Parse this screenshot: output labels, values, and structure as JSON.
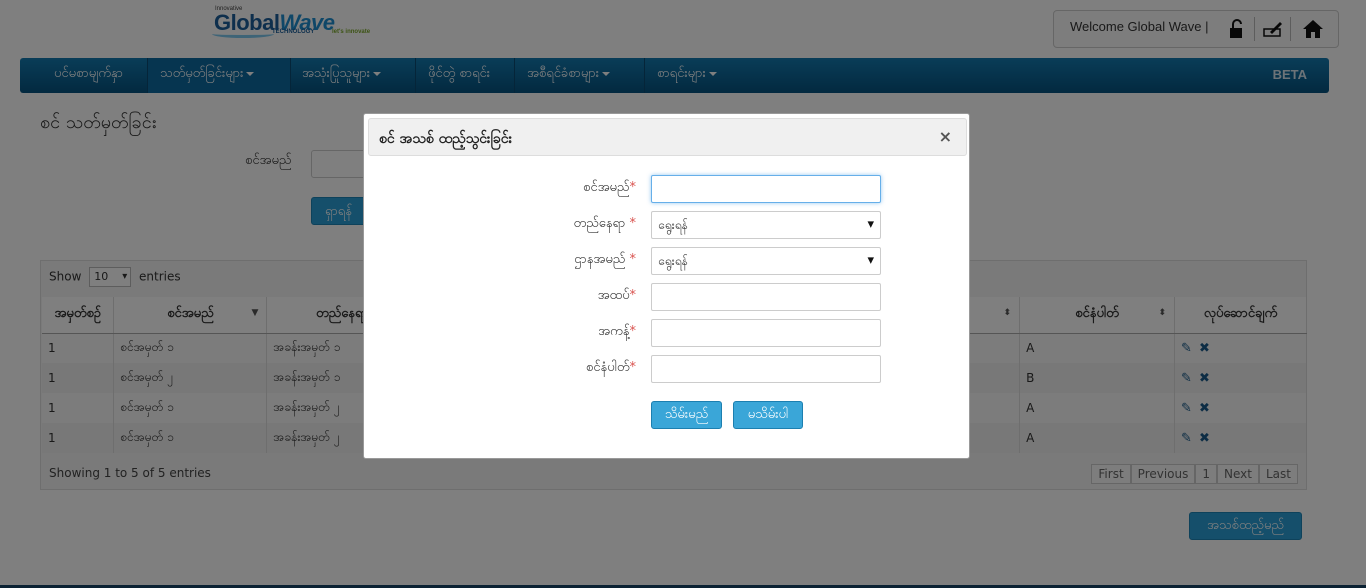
{
  "header": {
    "logo_small": "Innovative",
    "logo_brand_a": "Global",
    "logo_brand_b": "Wave",
    "logo_tag": "TECHNOLOGY",
    "logo_tag2": "let's innovate",
    "welcome": "Welcome  Global Wave |"
  },
  "nav": {
    "items": [
      {
        "label": "ပင်မစာမျက်နှာ"
      },
      {
        "label": "သတ်မှတ်ခြင်းများ"
      },
      {
        "label": "အသုံးပြုသူများ"
      },
      {
        "label": "ဖိုင်တွဲ စာရင်း"
      },
      {
        "label": "အစီရင်ခံစာများ"
      },
      {
        "label": "စာရင်းများ"
      }
    ],
    "beta": "BETA"
  },
  "page": {
    "title": "စင် သတ်မှတ်ခြင်း",
    "search_label": "စင်အမည်",
    "search_button": "ရှာရန်",
    "add_button": "အသစ်ထည့်မည်"
  },
  "table": {
    "show_label": "Show",
    "show_value": "10",
    "entries_label": "entries",
    "headers": [
      "အမှတ်စဉ်",
      "စင်အမည်",
      "တည်နေရာ",
      "",
      "စင်နံပါတ်",
      "လုပ်ဆောင်ချက်"
    ],
    "rows": [
      {
        "no": "1",
        "name": "စင်အမှတ် ၁",
        "location": "အခန်းအမှတ် ၁",
        "code": "A"
      },
      {
        "no": "1",
        "name": "စင်အမှတ် ၂",
        "location": "အခန်းအမှတ် ၁",
        "code": "B"
      },
      {
        "no": "1",
        "name": "စင်အမှတ် ၁",
        "location": "အခန်းအမှတ် ၂",
        "code": "A"
      },
      {
        "no": "1",
        "name": "စင်အမှတ် ၁",
        "location": "အခန်းအမှတ် ၂",
        "code": "A"
      }
    ],
    "info": "Showing 1 to 5 of 5 entries",
    "pager": [
      "First",
      "Previous",
      "1",
      "Next",
      "Last"
    ]
  },
  "modal": {
    "title": "စင် အသစ် ထည့်သွင်းခြင်း",
    "close": "×",
    "fields": [
      {
        "label": "စင်အမည်",
        "required": "*",
        "value": ""
      },
      {
        "label": "တည်နေရာ",
        "required": " *",
        "value": "ရွေးရန်"
      },
      {
        "label": "ဌာနအမည်",
        "required": " *",
        "value": "ရွေးရန်"
      },
      {
        "label": "အထပ်",
        "required": "*",
        "value": ""
      },
      {
        "label": "အကန့်",
        "required": "*",
        "value": ""
      },
      {
        "label": "စင်နံပါတ်",
        "required": "*",
        "value": ""
      }
    ],
    "save": "သိမ်းမည်",
    "cancel": "မသိမ်းပါ"
  }
}
